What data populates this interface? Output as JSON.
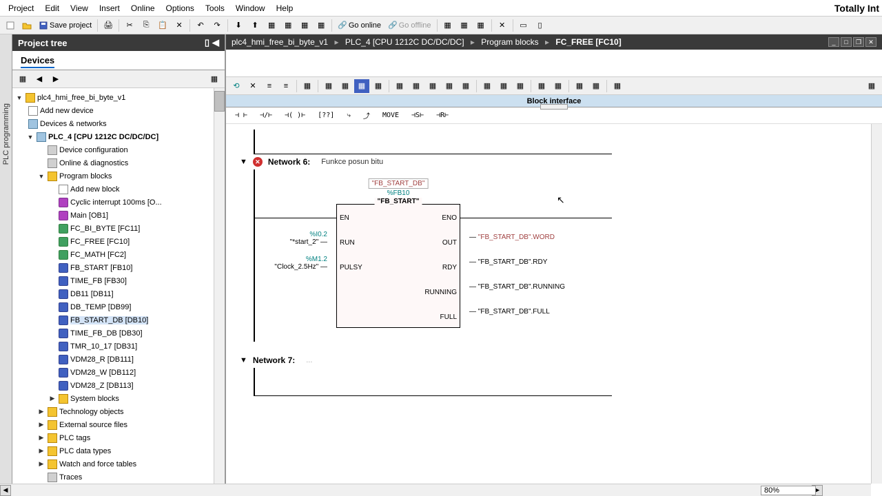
{
  "menubar": {
    "items": [
      "Project",
      "Edit",
      "View",
      "Insert",
      "Online",
      "Options",
      "Tools",
      "Window",
      "Help"
    ]
  },
  "brand": "Totally Int",
  "toolbar": {
    "save_label": "Save project",
    "go_online": "Go online",
    "go_offline": "Go offline"
  },
  "sidetab": "PLC programming",
  "tree": {
    "header": "Project tree",
    "devices_tab": "Devices",
    "root": "plc4_hmi_free_bi_byte_v1",
    "add_device": "Add new device",
    "devices_networks": "Devices & networks",
    "plc_node": "PLC_4 [CPU 1212C DC/DC/DC]",
    "device_config": "Device configuration",
    "online_diag": "Online & diagnostics",
    "program_blocks": "Program blocks",
    "add_block": "Add new block",
    "blocks": [
      "Cyclic interrupt 100ms [O...",
      "Main [OB1]",
      "FC_BI_BYTE [FC11]",
      "FC_FREE [FC10]",
      "FC_MATH [FC2]",
      "FB_START [FB10]",
      "TIME_FB [FB30]",
      "DB11 [DB11]",
      "DB_TEMP [DB99]",
      "FB_START_DB [DB10]",
      "TIME_FB_DB [DB30]",
      "TMR_10_17 [DB31]",
      "VDM28_R [DB111]",
      "VDM28_W [DB112]",
      "VDM28_Z [DB113]"
    ],
    "system_blocks": "System blocks",
    "tech_objects": "Technology objects",
    "ext_sources": "External source files",
    "plc_tags": "PLC tags",
    "plc_types": "PLC data types",
    "watch_tables": "Watch and force tables",
    "traces": "Traces"
  },
  "breadcrumb": {
    "p1": "plc4_hmi_free_bi_byte_v1",
    "p2": "PLC_4 [CPU 1212C DC/DC/DC]",
    "p3": "Program blocks",
    "p4": "FC_FREE [FC10]"
  },
  "block_interface": "Block interface",
  "ladder_tools": {
    "move": "MOVE"
  },
  "network6": {
    "title": "Network 6:",
    "comment": "Funkce posun bitu",
    "fb_instance": "\"FB_START_DB\"",
    "fb_type": "%FB10",
    "fb_name": "\"FB_START\"",
    "en": "EN",
    "eno": "ENO",
    "pins_left": [
      {
        "addr": "%I0.2",
        "tag": "\"*start_2\"",
        "name": "RUN"
      },
      {
        "addr": "%M1.2",
        "tag": "\"Clock_2.5Hz\"",
        "name": "PULSY"
      }
    ],
    "pins_right": [
      {
        "name": "OUT",
        "val": "\"FB_START_DB\".WORD"
      },
      {
        "name": "RDY",
        "val": "\"FB_START_DB\".RDY"
      },
      {
        "name": "RUNNING",
        "val": "\"FB_START_DB\".RUNNING"
      },
      {
        "name": "FULL",
        "val": "\"FB_START_DB\".FULL"
      }
    ]
  },
  "network7": {
    "title": "Network 7:",
    "comment": "..."
  },
  "zoom": "80%"
}
